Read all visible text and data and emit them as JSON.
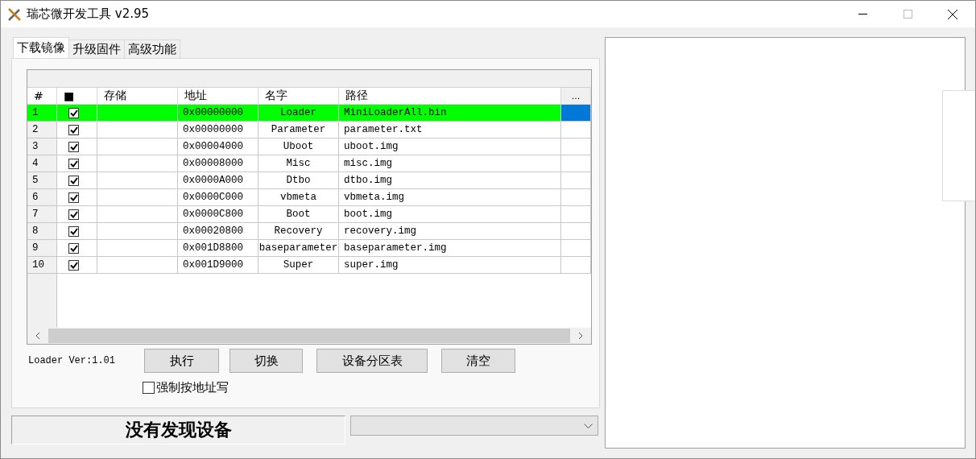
{
  "window": {
    "title": "瑞芯微开发工具 v2.95"
  },
  "tabs": [
    {
      "label": "下载镜像",
      "selected": true
    },
    {
      "label": "升级固件",
      "selected": false
    },
    {
      "label": "高级功能",
      "selected": false
    }
  ],
  "table": {
    "columns": [
      "#",
      "■",
      "存储",
      "地址",
      "名字",
      "路径",
      "..."
    ],
    "rows": [
      {
        "index": "1",
        "checked": true,
        "selected": true,
        "address": "0x00000000",
        "name": "Loader",
        "path": "MiniLoaderAll.bin"
      },
      {
        "index": "2",
        "checked": true,
        "selected": false,
        "address": "0x00000000",
        "name": "Parameter",
        "path": "parameter.txt"
      },
      {
        "index": "3",
        "checked": true,
        "selected": false,
        "address": "0x00004000",
        "name": "Uboot",
        "path": "uboot.img"
      },
      {
        "index": "4",
        "checked": true,
        "selected": false,
        "address": "0x00008000",
        "name": "Misc",
        "path": "misc.img"
      },
      {
        "index": "5",
        "checked": true,
        "selected": false,
        "address": "0x0000A000",
        "name": "Dtbo",
        "path": "dtbo.img"
      },
      {
        "index": "6",
        "checked": true,
        "selected": false,
        "address": "0x0000C000",
        "name": "vbmeta",
        "path": "vbmeta.img"
      },
      {
        "index": "7",
        "checked": true,
        "selected": false,
        "address": "0x0000C800",
        "name": "Boot",
        "path": "boot.img"
      },
      {
        "index": "8",
        "checked": true,
        "selected": false,
        "address": "0x00020800",
        "name": "Recovery",
        "path": "recovery.img"
      },
      {
        "index": "9",
        "checked": true,
        "selected": false,
        "address": "0x001D8800",
        "name": "baseparameter",
        "path": "baseparameter.img"
      },
      {
        "index": "10",
        "checked": true,
        "selected": false,
        "address": "0x001D9000",
        "name": "Super",
        "path": "super.img"
      }
    ]
  },
  "loader_version": "Loader Ver:1.01",
  "buttons": [
    "执行",
    "切换",
    "设备分区表",
    "清空"
  ],
  "force_address_write": {
    "label": "强制按地址写",
    "checked": false
  },
  "status": "没有发现设备"
}
